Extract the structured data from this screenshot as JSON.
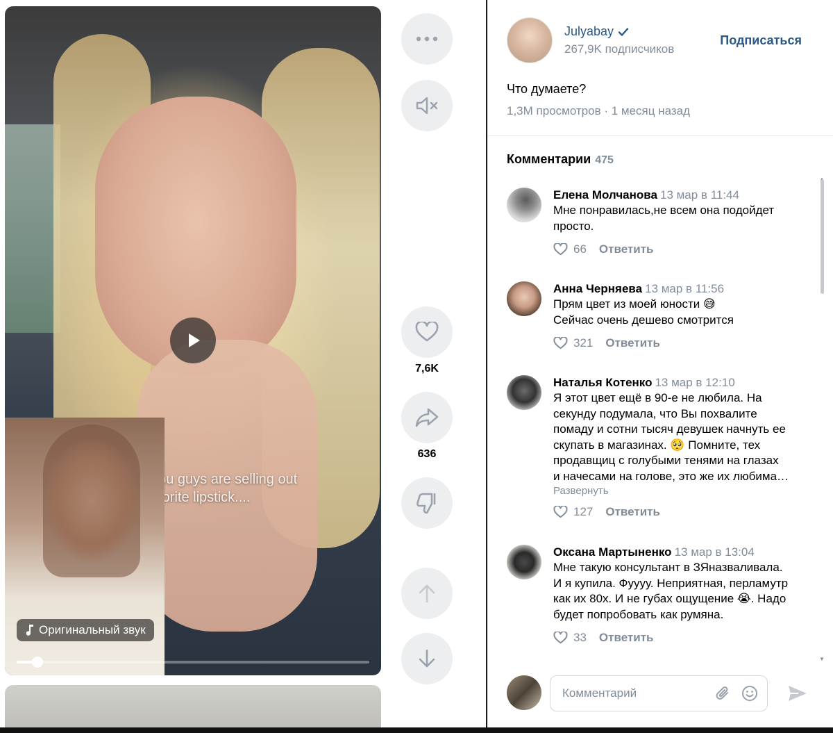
{
  "video": {
    "overlay_text_line1": "I you guys are selling out",
    "overlay_text_line2": "favorite lipstick....",
    "sound_label": "Оригинальный звук",
    "progress": 0.06
  },
  "actions": {
    "likes_count": "7,6K",
    "shares_count": "636"
  },
  "author": {
    "name": "Julyabay",
    "verified": true,
    "subscribers": "267,9K подписчиков",
    "subscribe_label": "Подписаться"
  },
  "post": {
    "caption": "Что думаете?",
    "meta": "1,3M просмотров · 1 месяц назад"
  },
  "comments_section": {
    "title": "Комментарии",
    "count": "475",
    "reply_label": "Ответить",
    "expand_label": "Развернуть"
  },
  "comments": [
    {
      "author": "Елена Молчанова",
      "date": "13 мар в 11:44",
      "lines": [
        "Мне понравилась,не всем она подойдет",
        "просто."
      ],
      "likes": "66",
      "reply": "Ответить"
    },
    {
      "author": "Анна Черняева",
      "date": "13 мар в 11:56",
      "lines": [
        "Прям цвет из моей юности 😅",
        "Сейчас очень дешево смотрится"
      ],
      "likes": "321",
      "reply": "Ответить"
    },
    {
      "author": "Наталья Котенко",
      "date": "13 мар в 12:10",
      "lines": [
        "Я этот цвет ещё в 90-е не любила. На",
        "секунду подумала, что Вы похвалите",
        "помаду и сотни тысяч девушек начнуть ее",
        "скупать в магазинах. 🥺 Помните, тех",
        "продавщиц с голубыми тенями на глазах",
        "и начесами на голове, это же их любима…"
      ],
      "expand": "Развернуть",
      "likes": "127",
      "reply": "Ответить"
    },
    {
      "author": "Оксана Мартыненко",
      "date": "13 мар в 13:04",
      "lines": [
        "Мне такую консультант в ЗЯназваливала.",
        "И я купила. Фуууу. Неприятная, перламутр",
        "как их 80х. И не губах ощущение 😭. Надо",
        "будет попробовать как румяна."
      ],
      "likes": "33",
      "reply": "Ответить"
    }
  ],
  "composer": {
    "placeholder": "Комментарий"
  },
  "icons": {
    "more": "more-horizontal-icon",
    "mute": "volume-muted-icon",
    "like": "heart-icon",
    "share": "share-arrow-icon",
    "dislike": "thumbs-down-icon",
    "prev": "arrow-up-icon",
    "next": "arrow-down-icon",
    "attach": "paperclip-icon",
    "emoji": "smile-icon",
    "send": "send-icon",
    "play": "play-icon",
    "verified": "verified-check-icon",
    "music": "music-note-icon"
  },
  "colors": {
    "link": "#2a5885",
    "secondary_text": "#818c99",
    "action_bg": "#edeef0"
  }
}
